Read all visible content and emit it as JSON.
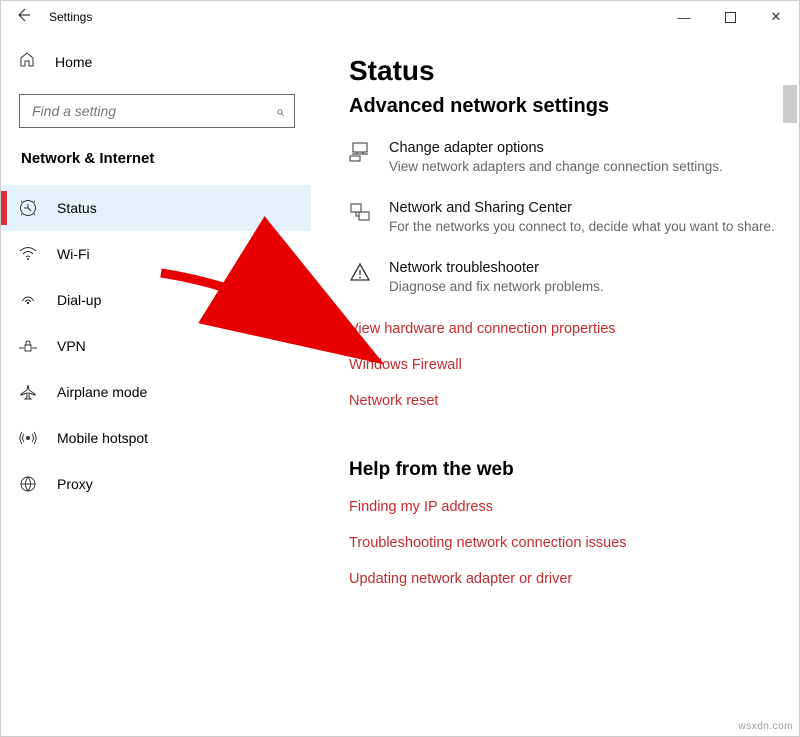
{
  "window": {
    "title": "Settings",
    "minimize": "—",
    "maximize": "▢",
    "close": "✕"
  },
  "sidebar": {
    "home": "Home",
    "search_placeholder": "Find a setting",
    "section": "Network & Internet",
    "items": [
      {
        "label": "Status",
        "icon": "status"
      },
      {
        "label": "Wi-Fi",
        "icon": "wifi"
      },
      {
        "label": "Dial-up",
        "icon": "dialup"
      },
      {
        "label": "VPN",
        "icon": "vpn"
      },
      {
        "label": "Airplane mode",
        "icon": "airplane"
      },
      {
        "label": "Mobile hotspot",
        "icon": "hotspot"
      },
      {
        "label": "Proxy",
        "icon": "proxy"
      }
    ]
  },
  "main": {
    "heading": "Status",
    "subheading": "Advanced network settings",
    "settings": [
      {
        "title": "Change adapter options",
        "desc": "View network adapters and change connection settings."
      },
      {
        "title": "Network and Sharing Center",
        "desc": "For the networks you connect to, decide what you want to share."
      },
      {
        "title": "Network troubleshooter",
        "desc": "Diagnose and fix network problems."
      }
    ],
    "links": [
      "View hardware and connection properties",
      "Windows Firewall",
      "Network reset"
    ],
    "help_heading": "Help from the web",
    "help_links": [
      "Finding my IP address",
      "Troubleshooting network connection issues",
      "Updating network adapter or driver"
    ]
  },
  "watermark": "wsxdn.com"
}
